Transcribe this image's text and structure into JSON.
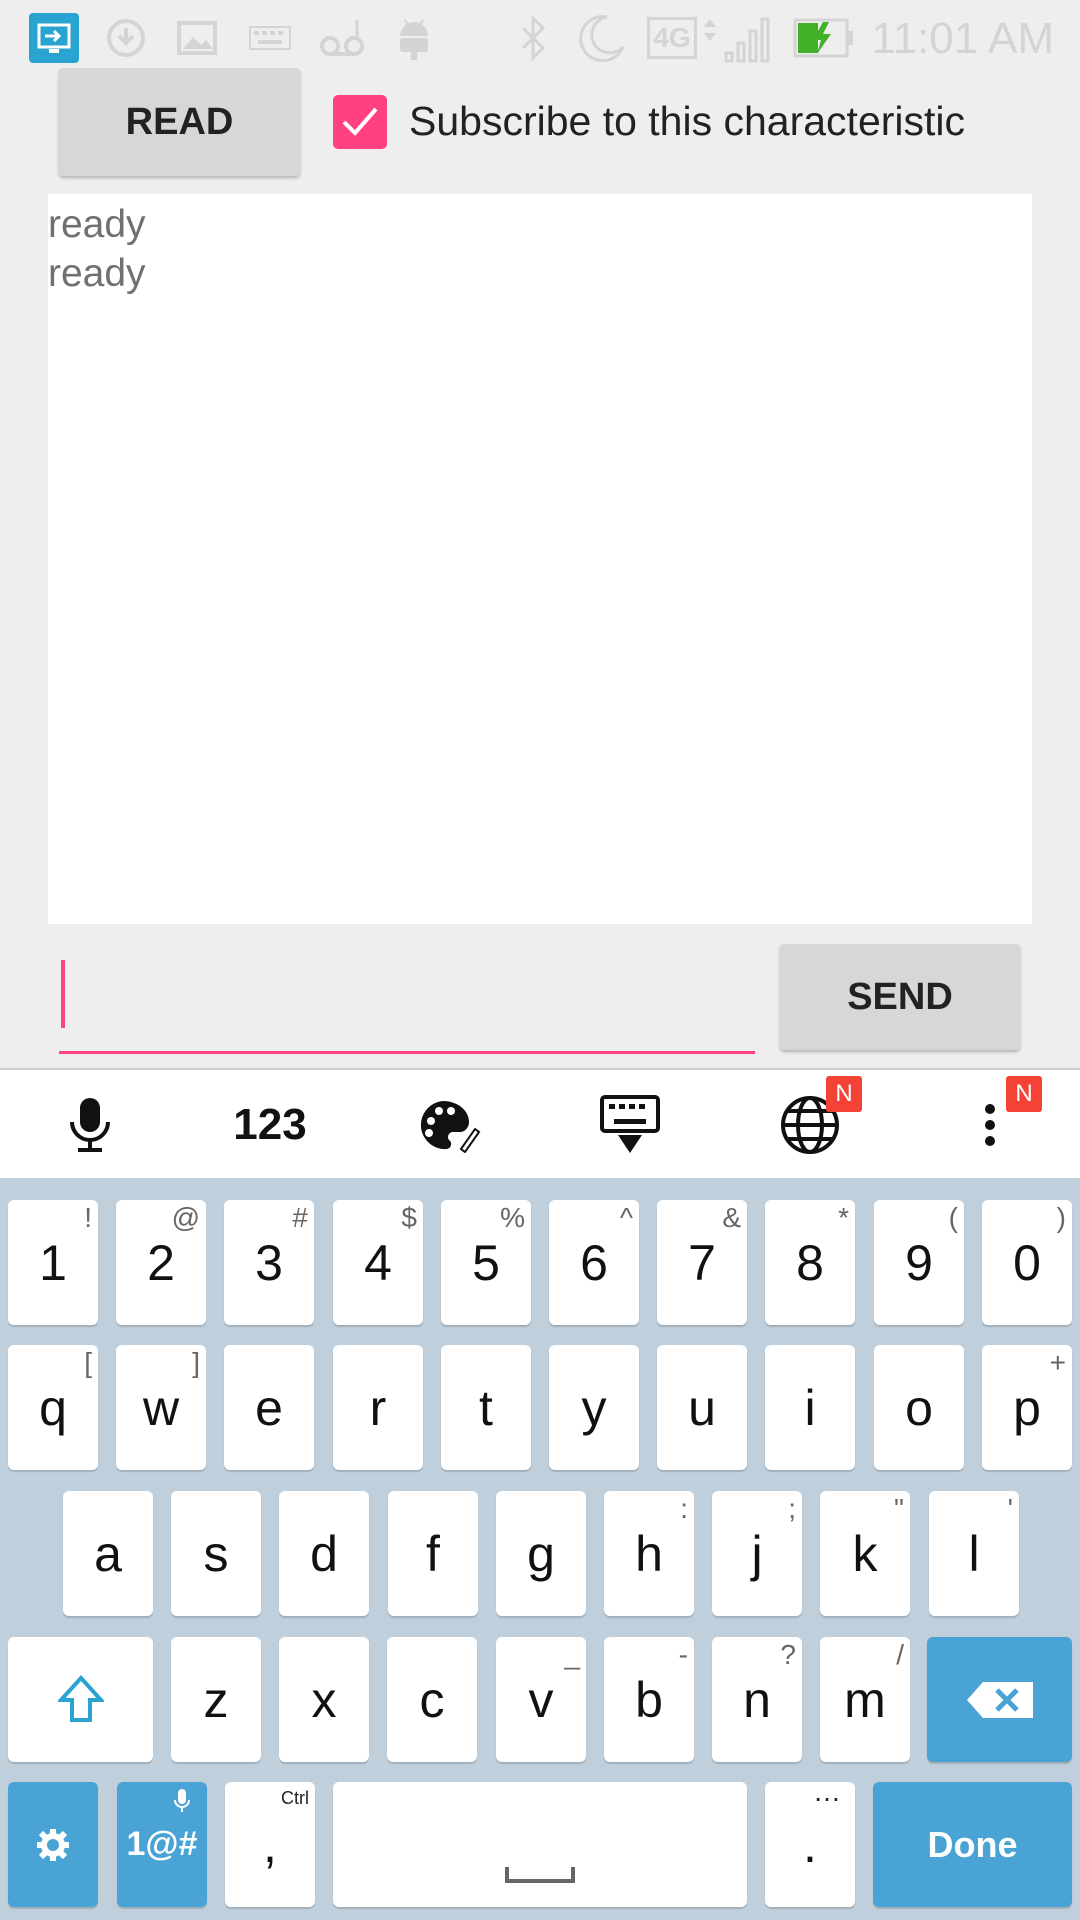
{
  "status_bar": {
    "time": "11:01 AM",
    "network": "4G",
    "icons": [
      "screen-mirror-icon",
      "download-icon",
      "image-icon",
      "keyboard-icon",
      "voicemail-icon",
      "android-icon",
      "bluetooth-icon",
      "moon-icon",
      "signal-icon",
      "battery-charging-icon"
    ]
  },
  "app": {
    "read_button": "READ",
    "subscribe_label": "Subscribe to this characteristic",
    "subscribe_checked": true,
    "log_lines": [
      "ready",
      "ready"
    ],
    "message_input": {
      "value": "",
      "placeholder": ""
    },
    "send_button": "SEND",
    "accent_color": "#ff4081"
  },
  "keyboard": {
    "toolbar": {
      "numbers_label": "123",
      "badge_globe": "N",
      "badge_more": "N"
    },
    "row_numbers": [
      {
        "k": "1",
        "h": "!"
      },
      {
        "k": "2",
        "h": "@"
      },
      {
        "k": "3",
        "h": "#"
      },
      {
        "k": "4",
        "h": "$"
      },
      {
        "k": "5",
        "h": "%"
      },
      {
        "k": "6",
        "h": "^"
      },
      {
        "k": "7",
        "h": "&"
      },
      {
        "k": "8",
        "h": "*"
      },
      {
        "k": "9",
        "h": "("
      },
      {
        "k": "0",
        "h": ")"
      }
    ],
    "row_q": [
      {
        "k": "q",
        "h": "["
      },
      {
        "k": "w",
        "h": "]"
      },
      {
        "k": "e",
        "h": ""
      },
      {
        "k": "r",
        "h": ""
      },
      {
        "k": "t",
        "h": ""
      },
      {
        "k": "y",
        "h": ""
      },
      {
        "k": "u",
        "h": ""
      },
      {
        "k": "i",
        "h": ""
      },
      {
        "k": "o",
        "h": ""
      },
      {
        "k": "p",
        "h": "+"
      }
    ],
    "row_a": [
      {
        "k": "a",
        "h": ""
      },
      {
        "k": "s",
        "h": ""
      },
      {
        "k": "d",
        "h": ""
      },
      {
        "k": "f",
        "h": ""
      },
      {
        "k": "g",
        "h": ""
      },
      {
        "k": "h",
        "h": ":"
      },
      {
        "k": "j",
        "h": ";"
      },
      {
        "k": "k",
        "h": "\""
      },
      {
        "k": "l",
        "h": "'"
      }
    ],
    "row_z": [
      {
        "k": "z",
        "h": ""
      },
      {
        "k": "x",
        "h": ""
      },
      {
        "k": "c",
        "h": ""
      },
      {
        "k": "v",
        "h": "_"
      },
      {
        "k": "b",
        "h": "-"
      },
      {
        "k": "n",
        "h": "?"
      },
      {
        "k": "m",
        "h": "/"
      }
    ],
    "symbols_label": "1@#",
    "comma": ",",
    "comma_hint": "Ctrl",
    "period": ".",
    "period_hint": "…",
    "done_label": "Done",
    "key_color": "#ffffff",
    "action_color": "#4aa3d5",
    "background_color": "#bfcfdb"
  }
}
